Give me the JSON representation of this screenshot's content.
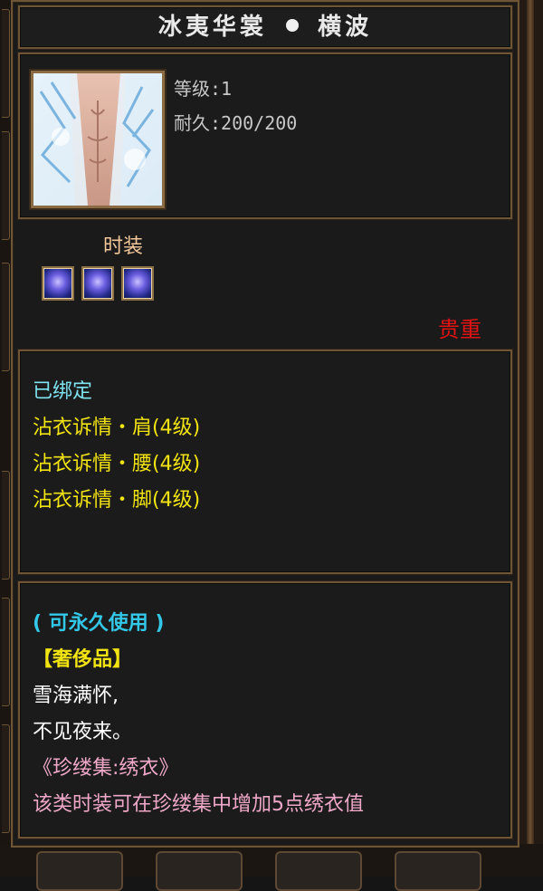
{
  "item": {
    "name": "冰夷华裳",
    "variant": "横波",
    "level_label": "等级:1",
    "durability_label": "耐久:200/200",
    "type_label": "时装",
    "rarity_label": "贵重"
  },
  "bindings": {
    "status": "已绑定",
    "effects": [
      "沾衣诉情・肩(4级)",
      "沾衣诉情・腰(4级)",
      "沾衣诉情・脚(4级)"
    ]
  },
  "description": {
    "usage": "( 可永久使用 )",
    "category": "【奢侈品】",
    "poem_line1": "雪海满怀,",
    "poem_line2": "不见夜来。",
    "collection": "《珍缕集:绣衣》",
    "collection_note": "该类时装可在珍缕集中增加5点绣衣值"
  },
  "colors": {
    "title": "#e9e9e9",
    "stats": "#c8c8c8",
    "type": "#f2c79a",
    "precious": "#e01212",
    "bound": "#7fe3f0",
    "effect": "#f2e312",
    "usage": "#33c8e8",
    "category": "#f2e312",
    "poem": "#ffffff",
    "collection": "#f0a8c8"
  }
}
